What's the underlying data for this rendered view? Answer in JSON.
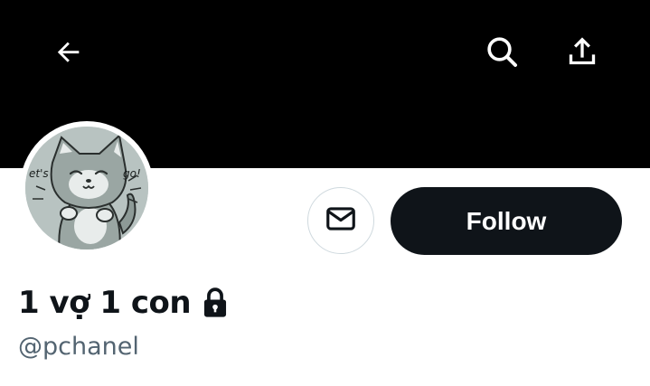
{
  "profile": {
    "display_name": "1 vợ 1 con",
    "handle": "@pchanel",
    "protected": true
  },
  "header": {
    "back_icon": "arrow-left-icon",
    "search_icon": "search-icon",
    "share_icon": "share-upload-icon"
  },
  "actions": {
    "message_icon": "envelope-icon",
    "follow_label": "Follow"
  },
  "avatar": {
    "sticker_text_left": "et's",
    "sticker_text_right": "go!"
  },
  "colors": {
    "banner": "#000000",
    "follow_bg": "#0f1419",
    "follow_text": "#ffffff",
    "handle": "#536471",
    "border": "#cfd9de"
  }
}
